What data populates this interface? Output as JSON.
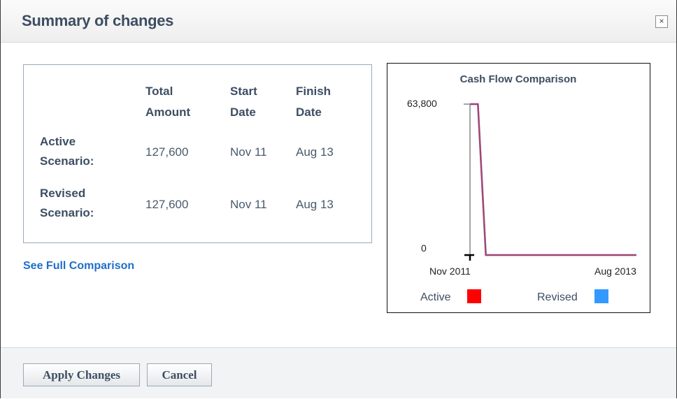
{
  "dialog": {
    "title": "Summary of changes",
    "close_label": "×"
  },
  "summary": {
    "columns": [
      {
        "line1": "Total",
        "line2": "Amount"
      },
      {
        "line1": "Start",
        "line2": "Date"
      },
      {
        "line1": "Finish",
        "line2": "Date"
      }
    ],
    "rows": [
      {
        "label1": "Active",
        "label2": "Scenario:",
        "total": "127,600",
        "start": "Nov 11",
        "finish": "Aug 13"
      },
      {
        "label1": "Revised",
        "label2": "Scenario:",
        "total": "127,600",
        "start": "Nov 11",
        "finish": "Aug 13"
      }
    ],
    "link_label": "See Full Comparison"
  },
  "footer": {
    "apply_label": "Apply Changes",
    "cancel_label": "Cancel"
  },
  "chart_data": {
    "type": "line",
    "title": "Cash Flow Comparison",
    "x_tick_labels": [
      "Nov 2011",
      "Aug 2013"
    ],
    "y_ticks": [
      0,
      63800
    ],
    "y_tick_labels": [
      "0",
      "63,800"
    ],
    "ylim": [
      0,
      63800
    ],
    "xlim": [
      "2011-11",
      "2013-08"
    ],
    "x": [
      "2011-11",
      "2011-12",
      "2012-01",
      "2012-02",
      "2013-08"
    ],
    "series": [
      {
        "name": "Active",
        "color": "#ff0000",
        "values": [
          63800,
          63800,
          0,
          0,
          0
        ]
      },
      {
        "name": "Revised",
        "color": "#3399ff",
        "values": [
          63800,
          63800,
          0,
          0,
          0
        ]
      }
    ],
    "legend_position": "bottom"
  }
}
